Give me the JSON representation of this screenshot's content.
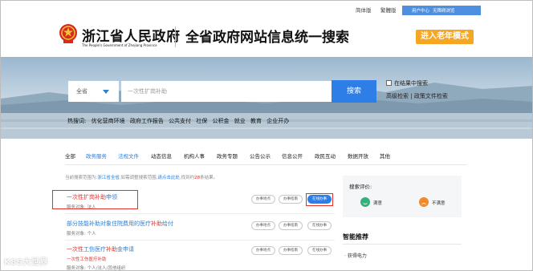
{
  "topbar": {
    "simplified": "简体版",
    "traditional": "繁體版",
    "user_center": "用户中心",
    "accessibility": "无障碍浏览"
  },
  "header": {
    "brand_cn": "浙江省人民政府",
    "brand_en": "The People's Government of Zhejiang Province",
    "site_title": "全省政府网站信息统一搜索",
    "elder_mode": "进入老年模式"
  },
  "search": {
    "scope_value": "全省",
    "query_value": "一次性扩岗补助",
    "button": "搜索",
    "in_results": "在结果中搜索",
    "advanced": "高级检索",
    "policy_search": "政策文件检索"
  },
  "hot": {
    "label": "热搜词:",
    "words": [
      "优化营商环境",
      "政府工作报告",
      "公共支付",
      "社保",
      "公积金",
      "就业",
      "教育",
      "企业开办"
    ]
  },
  "tabs": [
    "全部",
    "政务服务",
    "法规文件",
    "动态信息",
    "机构人事",
    "政务专题",
    "公告公示",
    "信息公开",
    "政民互动",
    "数据开放",
    "其他"
  ],
  "active_tabs": [
    1,
    2
  ],
  "scope": {
    "prefix": "当前搜索范围为:",
    "region": "浙江省全省",
    "mid": ",如需调整搜索范围,",
    "link": "请点击此处",
    "found": ",找到约",
    "count": "28",
    "suffix": "条结果。"
  },
  "results": [
    {
      "title_a": "一次性扩岗",
      "title_b": "补助",
      "title_c": "申领",
      "target_label": "服务对象:",
      "target": "法人"
    },
    {
      "title_a": "部分技能补助",
      "title_b": "对象住院费用的医疗",
      "title_c": "补助",
      "title_d": "给付",
      "target_label": "服务对象:",
      "target": "个人"
    },
    {
      "title_a": "一次性",
      "title_b": "工伤医疗",
      "title_c": "补助",
      "title_d": "金申请",
      "extra": "一次性工伤医疗补助",
      "target_label": "服务对象:",
      "target": "个人/法人/其他组织"
    }
  ],
  "actions": {
    "guide_place": "办事地点",
    "guide": "办事指南",
    "online": "在线办事"
  },
  "evaluation": {
    "title": "搜索评价:",
    "satisfied": "满意",
    "unsatisfied": "不满意"
  },
  "smart": {
    "title": "智能推荐",
    "item": "· 获得电力"
  },
  "watermark": "K8S大世界"
}
